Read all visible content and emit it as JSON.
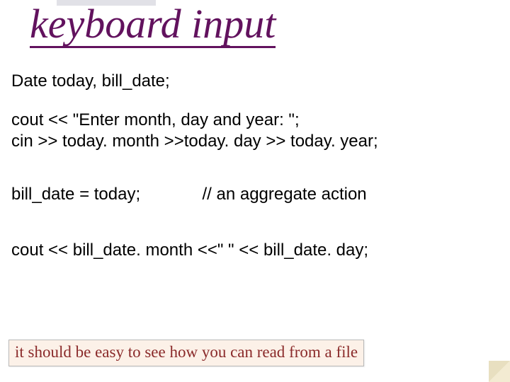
{
  "title": "keyboard input",
  "code": {
    "line1": "Date today, bill_date;",
    "line2": "cout << \"Enter month, day and year: \";",
    "line3": "cin >> today. month >>today. day  >> today. year;",
    "line4a": "bill_date = today;",
    "line4b": "// an aggregate action",
    "line5": "cout << bill_date. month <<\"  \"  << bill_date. day;"
  },
  "note": "it should be easy to see how you can read from a file"
}
